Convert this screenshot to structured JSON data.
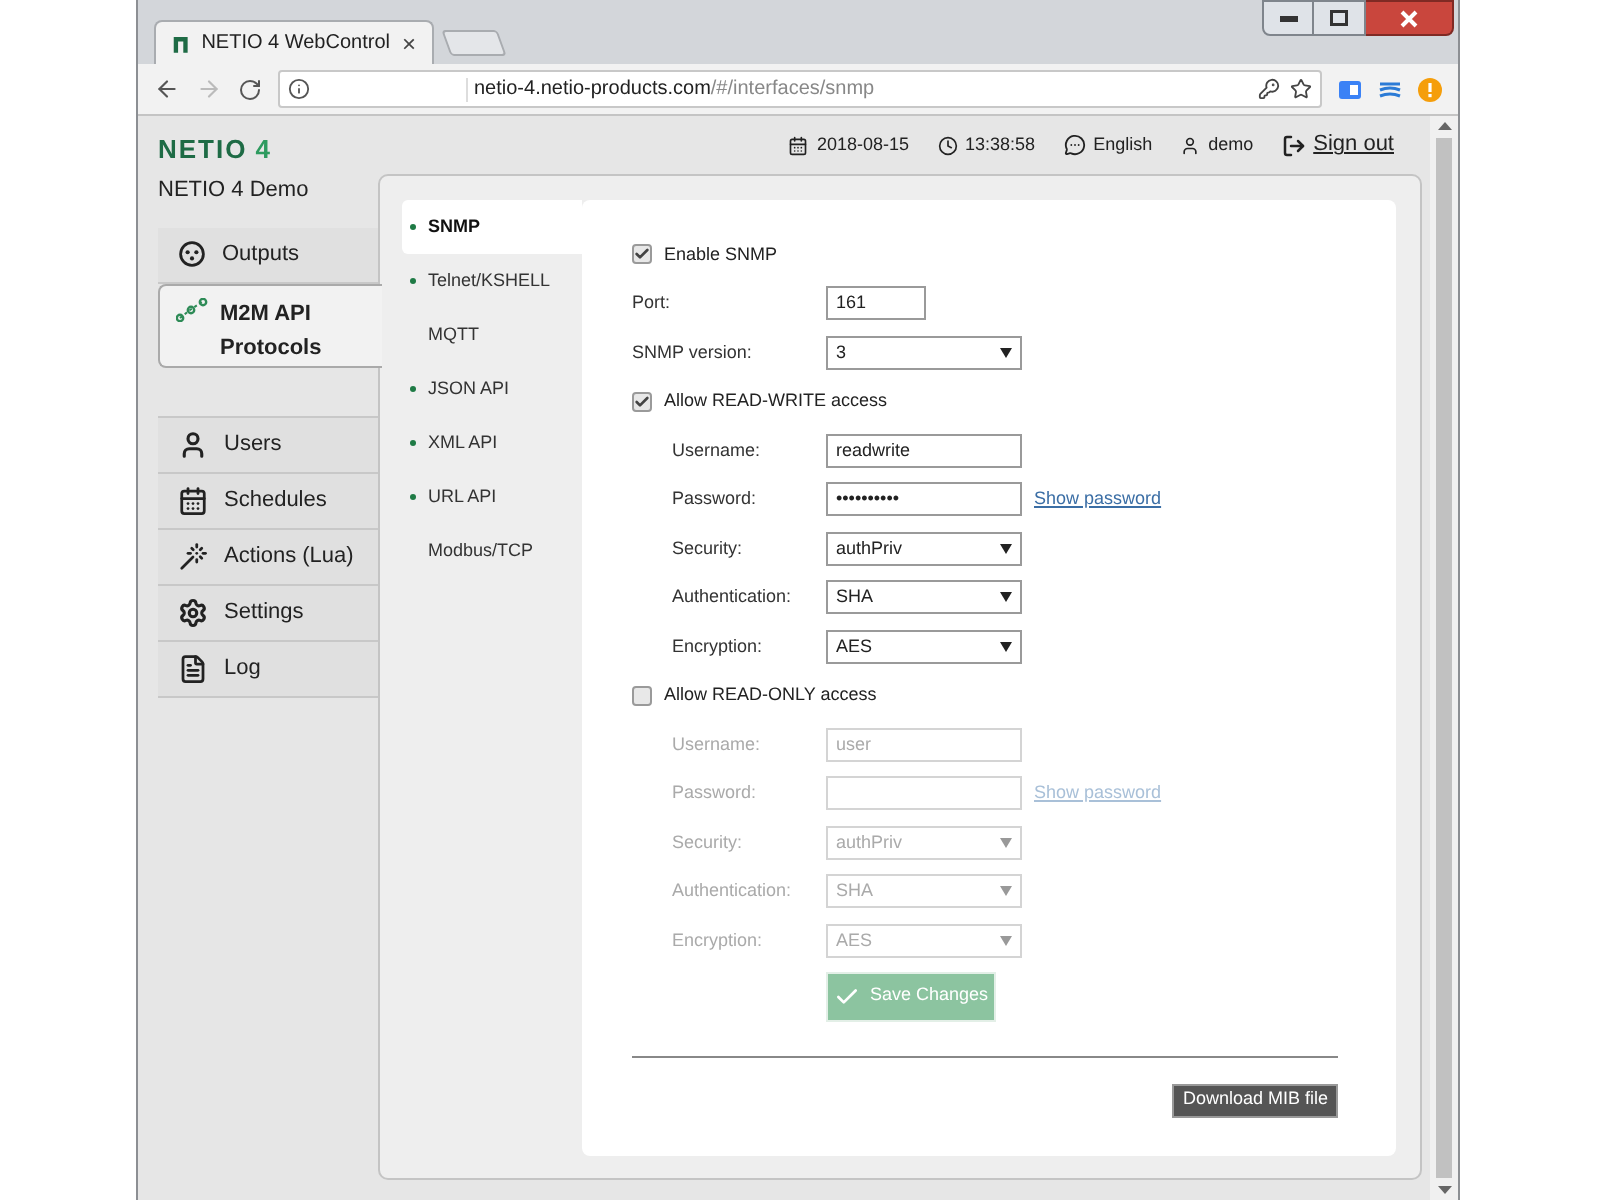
{
  "browser_tab": {
    "title": "NETIO 4 WebControl",
    "close": "×"
  },
  "address_bar": {
    "host": "netio-4.netio-products.com",
    "path": "/#/interfaces/snmp"
  },
  "header": {
    "logo_word": "NETIO",
    "logo_number": "4",
    "device_name": "NETIO 4 Demo",
    "date": "2018-08-15",
    "time": "13:38:58",
    "language": "English",
    "user": "demo",
    "sign_out": "Sign out"
  },
  "nav": [
    {
      "kind": "outputs",
      "label": "Outputs",
      "selected": false
    },
    {
      "kind": "m2m",
      "label": "M2M API Protocols",
      "selected": true
    },
    {
      "kind": "users",
      "label": "Users",
      "selected": false
    },
    {
      "kind": "schedules",
      "label": "Schedules",
      "selected": false
    },
    {
      "kind": "actions",
      "label": "Actions (Lua)",
      "selected": false
    },
    {
      "kind": "settings",
      "label": "Settings",
      "selected": false
    },
    {
      "kind": "log",
      "label": "Log",
      "selected": false
    }
  ],
  "subnav": [
    {
      "label": "SNMP",
      "selected": true,
      "active": true
    },
    {
      "label": "Telnet/KSHELL",
      "selected": false,
      "active": true
    },
    {
      "label": "MQTT",
      "selected": false,
      "active": false
    },
    {
      "label": "JSON API",
      "selected": false,
      "active": true
    },
    {
      "label": "XML API",
      "selected": false,
      "active": true
    },
    {
      "label": "URL API",
      "selected": false,
      "active": true
    },
    {
      "label": "Modbus/TCP",
      "selected": false,
      "active": false
    }
  ],
  "form": {
    "enable_snmp": {
      "label": "Enable SNMP",
      "checked": true
    },
    "port": {
      "label": "Port:",
      "value": "161"
    },
    "snmp_version": {
      "label": "SNMP version:",
      "value": "3"
    },
    "sections": [
      {
        "label": "Allow READ-WRITE access",
        "checked": true,
        "fields": [
          {
            "kind": "text",
            "label": "Username:",
            "value": "readwrite"
          },
          {
            "kind": "password",
            "label": "Password:",
            "value": "••••••••••",
            "link": "Show password"
          },
          {
            "kind": "select",
            "label": "Security:",
            "value": "authPriv"
          },
          {
            "kind": "select",
            "label": "Authentication:",
            "value": "SHA"
          },
          {
            "kind": "select",
            "label": "Encryption:",
            "value": "AES"
          }
        ]
      },
      {
        "label": "Allow READ-ONLY access",
        "checked": false,
        "fields": [
          {
            "kind": "text",
            "label": "Username:",
            "value": "user"
          },
          {
            "kind": "password",
            "label": "Password:",
            "link": "Show password"
          },
          {
            "kind": "select",
            "label": "Security:",
            "value": "authPriv"
          },
          {
            "kind": "select",
            "label": "Authentication:",
            "value": "SHA"
          },
          {
            "kind": "select",
            "label": "Encryption:",
            "value": "AES"
          }
        ]
      }
    ],
    "save_button": {
      "label": "Save Changes",
      "disabled": true
    },
    "download_button": "Download MIB file"
  }
}
